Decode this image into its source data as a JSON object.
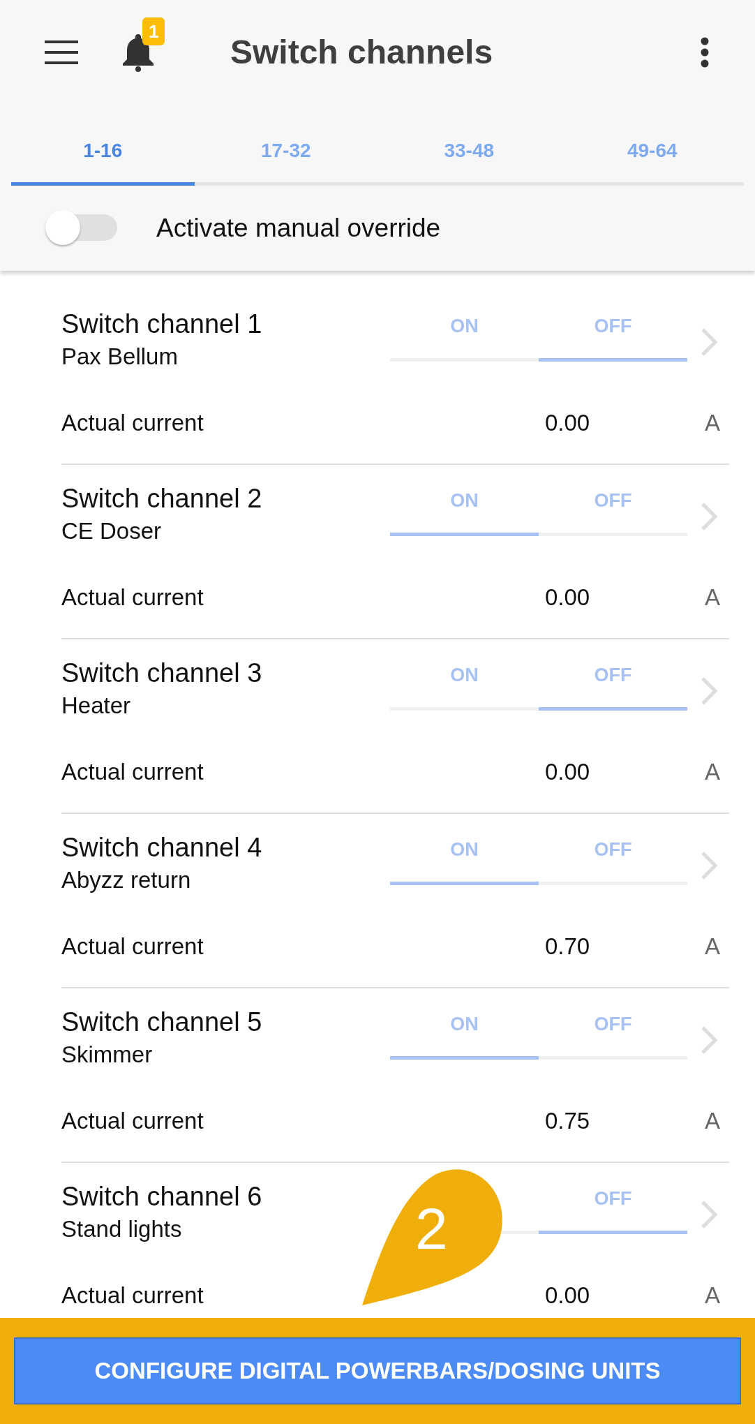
{
  "header": {
    "title": "Switch channels",
    "notification_count": "1"
  },
  "tabs": [
    {
      "label": "1-16",
      "selected": true
    },
    {
      "label": "17-32",
      "selected": false
    },
    {
      "label": "33-48",
      "selected": false
    },
    {
      "label": "49-64",
      "selected": false
    }
  ],
  "manual_override": {
    "label": "Activate manual override",
    "on": false
  },
  "channels": [
    {
      "name": "Switch channel 1",
      "device": "Pax Bellum",
      "on_label": "ON",
      "off_label": "OFF",
      "on": false,
      "current_label": "Actual current",
      "current": "0.00",
      "unit": "A"
    },
    {
      "name": "Switch channel 2",
      "device": "CE Doser",
      "on_label": "ON",
      "off_label": "OFF",
      "on": true,
      "current_label": "Actual current",
      "current": "0.00",
      "unit": "A"
    },
    {
      "name": "Switch channel 3",
      "device": "Heater",
      "on_label": "ON",
      "off_label": "OFF",
      "on": false,
      "current_label": "Actual current",
      "current": "0.00",
      "unit": "A"
    },
    {
      "name": "Switch channel 4",
      "device": "Abyzz return",
      "on_label": "ON",
      "off_label": "OFF",
      "on": true,
      "current_label": "Actual current",
      "current": "0.70",
      "unit": "A"
    },
    {
      "name": "Switch channel 5",
      "device": "Skimmer",
      "on_label": "ON",
      "off_label": "OFF",
      "on": true,
      "current_label": "Actual current",
      "current": "0.75",
      "unit": "A"
    },
    {
      "name": "Switch channel 6",
      "device": "Stand lights",
      "off_label": "OFF",
      "on": false,
      "current_label": "Actual current",
      "current": "0.00",
      "unit": "A"
    }
  ],
  "callout": {
    "number": "2"
  },
  "footer_button": {
    "label": "CONFIGURE DIGITAL POWERBARS/DOSING UNITS",
    "highlighted": true
  }
}
